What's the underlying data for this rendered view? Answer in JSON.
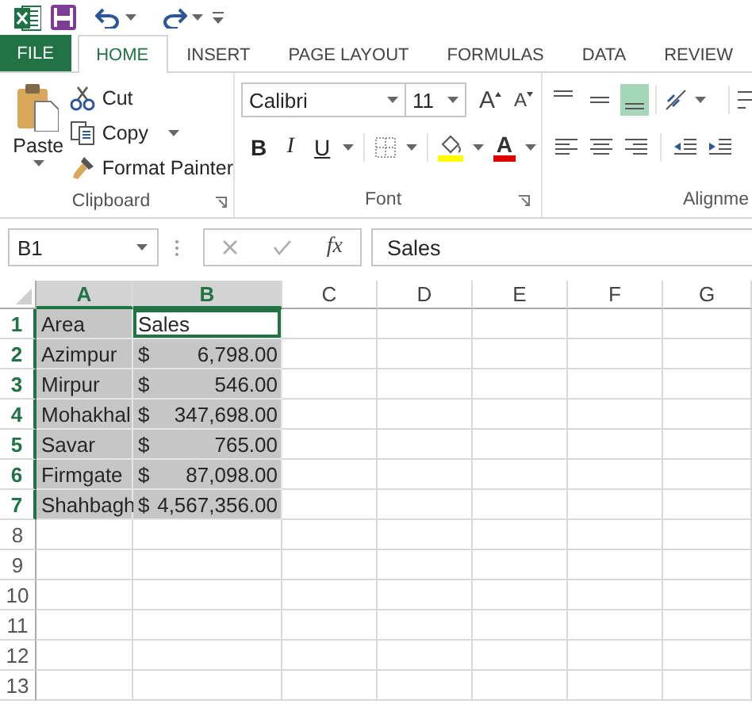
{
  "tabs": [
    {
      "label": "FILE",
      "kind": "file",
      "selected": false
    },
    {
      "label": "HOME",
      "kind": "tab",
      "selected": true
    },
    {
      "label": "INSERT",
      "kind": "tab",
      "selected": false
    },
    {
      "label": "PAGE LAYOUT",
      "kind": "tab",
      "selected": false
    },
    {
      "label": "FORMULAS",
      "kind": "tab",
      "selected": false
    },
    {
      "label": "DATA",
      "kind": "tab",
      "selected": false
    },
    {
      "label": "REVIEW",
      "kind": "tab",
      "selected": false
    }
  ],
  "ribbon": {
    "clipboard": {
      "paste": "Paste",
      "cut": "Cut",
      "copy": "Copy",
      "format_painter": "Format Painter",
      "label": "Clipboard"
    },
    "font": {
      "font_name": "Calibri",
      "font_size": "11",
      "grow": "A",
      "shrink": "A",
      "bold": "B",
      "italic": "I",
      "underline": "U",
      "font_color": "A",
      "label": "Font"
    },
    "alignment": {
      "vertical": [
        {
          "selected": false
        },
        {
          "selected": false
        },
        {
          "selected": true
        }
      ],
      "label": "Alignme"
    }
  },
  "formula_bar": {
    "name_box": "B1",
    "function_label": "fx",
    "formula": "Sales"
  },
  "grid": {
    "columns": [
      {
        "label": "A",
        "selected": true
      },
      {
        "label": "B",
        "selected": true
      },
      {
        "label": "C",
        "selected": false
      },
      {
        "label": "D",
        "selected": false
      },
      {
        "label": "E",
        "selected": false
      },
      {
        "label": "F",
        "selected": false
      },
      {
        "label": "G",
        "selected": false
      }
    ],
    "rows": [
      {
        "header": "1",
        "selected": true,
        "cells": [
          {
            "text": "Area",
            "selected": true,
            "active": false
          },
          {
            "text": "Sales",
            "selected": true,
            "active": true
          }
        ]
      },
      {
        "header": "2",
        "selected": true,
        "cells": [
          {
            "text": "Azimpur",
            "selected": true,
            "active": false
          },
          {
            "currency": "$",
            "text": "6,798.00",
            "selected": true,
            "active": false
          }
        ]
      },
      {
        "header": "3",
        "selected": true,
        "cells": [
          {
            "text": "Mirpur",
            "selected": true,
            "active": false
          },
          {
            "currency": "$",
            "text": "546.00",
            "selected": true,
            "active": false
          }
        ]
      },
      {
        "header": "4",
        "selected": true,
        "cells": [
          {
            "text": "Mohakhal",
            "selected": true,
            "active": false
          },
          {
            "currency": "$",
            "text": "347,698.00",
            "selected": true,
            "active": false
          }
        ]
      },
      {
        "header": "5",
        "selected": true,
        "cells": [
          {
            "text": "Savar",
            "selected": true,
            "active": false
          },
          {
            "currency": "$",
            "text": "765.00",
            "selected": true,
            "active": false
          }
        ]
      },
      {
        "header": "6",
        "selected": true,
        "cells": [
          {
            "text": "Firmgate",
            "selected": true,
            "active": false
          },
          {
            "currency": "$",
            "text": "87,098.00",
            "selected": true,
            "active": false
          }
        ]
      },
      {
        "header": "7",
        "selected": true,
        "cells": [
          {
            "text": "Shahbagh",
            "selected": true,
            "active": false
          },
          {
            "currency": "$",
            "text": "4,567,356.00",
            "selected": true,
            "active": false
          }
        ]
      },
      {
        "header": "8",
        "selected": false
      },
      {
        "header": "9",
        "selected": false
      },
      {
        "header": "10",
        "selected": false
      },
      {
        "header": "11",
        "selected": false
      },
      {
        "header": "12",
        "selected": false
      },
      {
        "header": "13",
        "selected": false
      }
    ]
  }
}
